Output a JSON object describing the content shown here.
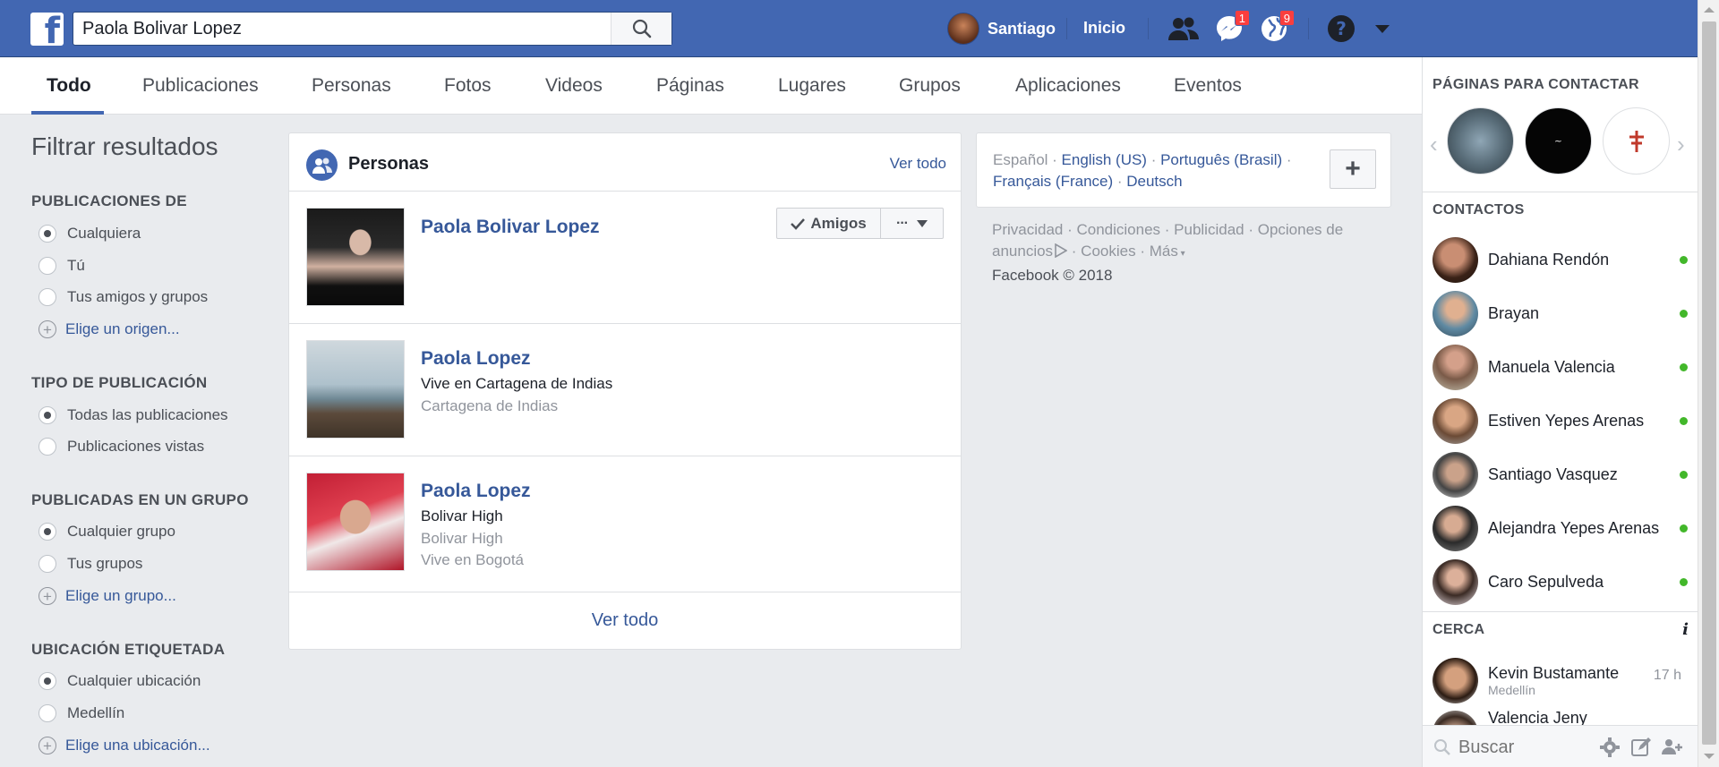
{
  "topbar": {
    "logo": "f",
    "search_value": "Paola Bolivar Lopez",
    "user_name": "Santiago",
    "home_label": "Inicio",
    "messages_badge": "1",
    "notifications_badge": "9",
    "colors": {
      "bar": "#4267b2",
      "badge": "#fa3e3e"
    }
  },
  "tabs": [
    "Todo",
    "Publicaciones",
    "Personas",
    "Fotos",
    "Videos",
    "Páginas",
    "Lugares",
    "Grupos",
    "Aplicaciones",
    "Eventos"
  ],
  "active_tab": "Todo",
  "filters": {
    "title": "Filtrar resultados",
    "sections": [
      {
        "heading": "PUBLICACIONES DE",
        "options": [
          "Cualquiera",
          "Tú",
          "Tus amigos y grupos"
        ],
        "selected": "Cualquiera",
        "add": "Elige un origen..."
      },
      {
        "heading": "TIPO DE PUBLICACIÓN",
        "options": [
          "Todas las publicaciones",
          "Publicaciones vistas"
        ],
        "selected": "Todas las publicaciones"
      },
      {
        "heading": "PUBLICADAS EN UN GRUPO",
        "options": [
          "Cualquier grupo",
          "Tus grupos"
        ],
        "selected": "Cualquier grupo",
        "add": "Elige un grupo..."
      },
      {
        "heading": "UBICACIÓN ETIQUETADA",
        "options": [
          "Cualquier ubicación",
          "Medellín"
        ],
        "selected": "Cualquier ubicación",
        "add": "Elige una ubicación..."
      }
    ]
  },
  "people_card": {
    "title": "Personas",
    "see_all_top": "Ver todo",
    "see_all_bottom": "Ver todo",
    "friends_button": "Amigos",
    "more_button": "···",
    "results": [
      {
        "name": "Paola Bolivar Lopez",
        "lines": []
      },
      {
        "name": "Paola Lopez",
        "lines": [
          [
            "Vive en Cartagena de Indias",
            "dark"
          ],
          [
            "Cartagena de Indias",
            "grey"
          ]
        ]
      },
      {
        "name": "Paola Lopez",
        "lines": [
          [
            "Bolivar High",
            "dark"
          ],
          [
            "Bolivar High",
            "grey"
          ],
          [
            "Vive en Bogotá",
            "grey"
          ]
        ]
      }
    ]
  },
  "languages": {
    "current": "Español",
    "links": [
      "English (US)",
      "Português (Brasil)",
      "Français (France)",
      "Deutsch"
    ],
    "add": "+"
  },
  "footer": {
    "links": [
      "Privacidad",
      "Condiciones",
      "Publicidad",
      "Opciones de anuncios",
      "Cookies",
      "Más"
    ],
    "copyright": "Facebook © 2018"
  },
  "sidebar": {
    "pages_heading": "PÁGINAS PARA CONTACTAR",
    "contacts_heading": "CONTACTOS",
    "contacts": [
      "Dahiana Rendón",
      "Brayan",
      "Manuela Valencia",
      "Estiven Yepes Arenas",
      "Santiago Vasquez",
      "Alejandra Yepes Arenas",
      "Caro Sepulveda"
    ],
    "nearby_heading": "CERCA",
    "nearby": [
      {
        "name": "Kevin Bustamante",
        "sub": "Medellín",
        "time": "17 h"
      },
      {
        "name": "Valencia Jeny",
        "sub": "",
        "time": ""
      }
    ],
    "search_placeholder": "Buscar"
  }
}
